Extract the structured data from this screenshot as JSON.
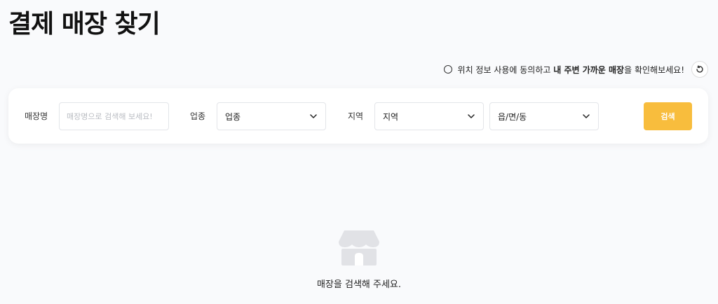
{
  "page": {
    "title": "결제 매장 찾기"
  },
  "location": {
    "prefix": "위치 정보 사용에 동의하고 ",
    "emphasis": "내 주변 가까운 매장",
    "suffix": "을 확인해보세요!"
  },
  "search": {
    "store_label": "매장명",
    "store_placeholder": "매장명으로 검색해 보세요!",
    "category_label": "업종",
    "category_value": "업종",
    "region_label": "지역",
    "region_value": "지역",
    "district_value": "읍/면/동",
    "button_label": "검색"
  },
  "empty": {
    "message": "매장을 검색해 주세요."
  },
  "colors": {
    "accent": "#f8bd3d",
    "background": "#f9fafc",
    "icon": "#e1e2e6"
  },
  "icons": {
    "consent": "radio-circle-icon",
    "refresh": "refresh-icon",
    "dropdown": "chevron-down-icon",
    "empty": "store-icon"
  }
}
